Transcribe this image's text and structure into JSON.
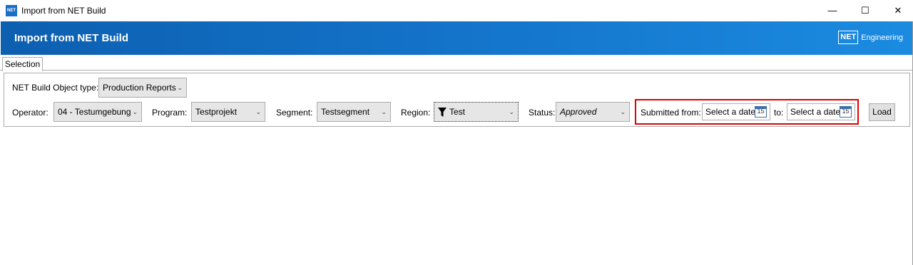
{
  "window": {
    "title": "Import from NET Build",
    "app_icon_label": "NET",
    "buttons": {
      "minimize": "—",
      "maximize": "☐",
      "close": "✕"
    }
  },
  "banner": {
    "title": "Import from NET Build",
    "brand_box": "NET",
    "brand_text": "Engineering",
    "gradient_colors": [
      "#0d5fb0",
      "#1b8be0"
    ]
  },
  "tabs": [
    {
      "label": "Selection",
      "active": true
    }
  ],
  "selection": {
    "object_type": {
      "label": "NET Build Object type:",
      "value": "Production Reports"
    },
    "operator": {
      "label": "Operator:",
      "value": "04 - Testumgebung"
    },
    "program": {
      "label": "Program:",
      "value": "Testprojekt"
    },
    "segment": {
      "label": "Segment:",
      "value": "Testsegment"
    },
    "region": {
      "label": "Region:",
      "value": "Test",
      "icon": "filter-icon"
    },
    "status": {
      "label": "Status:",
      "value": "Approved"
    },
    "submitted_from": {
      "label": "Submitted from:",
      "placeholder": "Select a date",
      "icon_text": "15"
    },
    "submitted_to": {
      "label": "to:",
      "placeholder": "Select a date",
      "icon_text": "15"
    },
    "load_button": "Load"
  },
  "highlight_color": "#e00000"
}
